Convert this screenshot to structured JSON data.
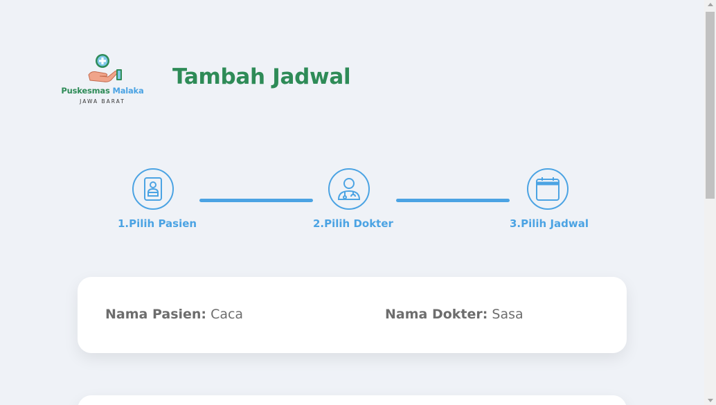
{
  "logo": {
    "name_part1": "Puskesmas",
    "name_part2": "Malaka",
    "region": "JAWA BARAT"
  },
  "page_title": "Tambah Jadwal",
  "steps": [
    {
      "label": "1.Pilih Pasien",
      "icon": "patient-id-icon"
    },
    {
      "label": "2.Pilih Dokter",
      "icon": "doctor-icon"
    },
    {
      "label": "3.Pilih Jadwal",
      "icon": "calendar-icon"
    }
  ],
  "summary": {
    "patient_key": "Nama Pasien:",
    "patient_value": "Caca",
    "doctor_key": "Nama Dokter:",
    "doctor_value": "Sasa"
  },
  "colors": {
    "brand_green": "#2e8b57",
    "accent_blue": "#4ba3e3",
    "background": "#eff2f7"
  }
}
